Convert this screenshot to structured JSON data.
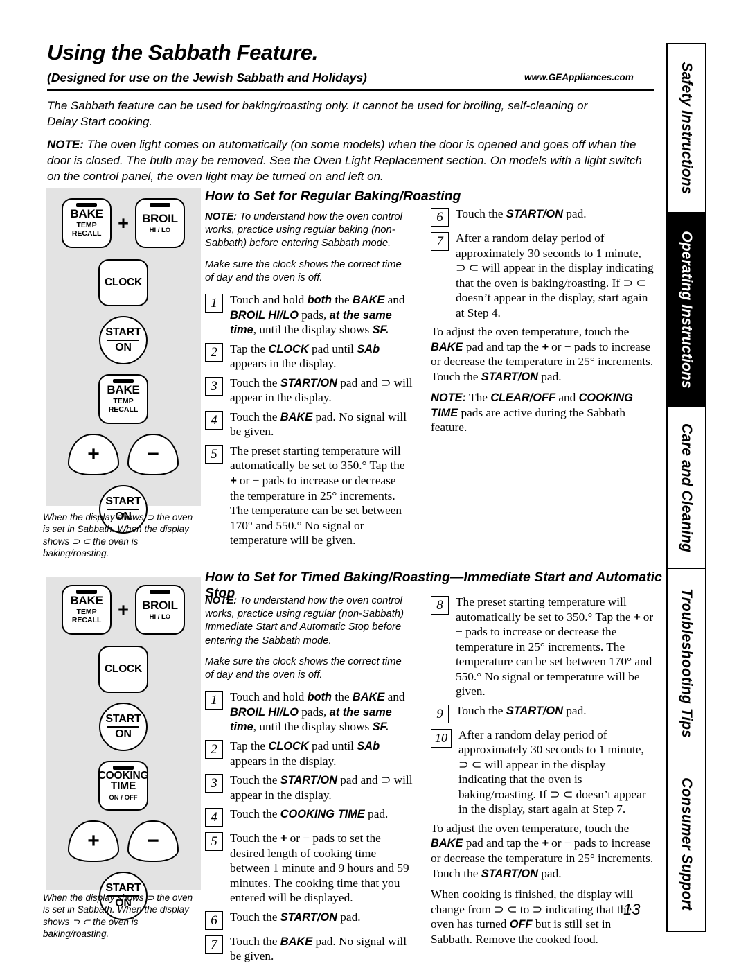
{
  "header": {
    "title": "Using the Sabbath Feature.",
    "subtitle": "(Designed for use on the Jewish Sabbath and Holidays)",
    "url": "www.GEAppliances.com"
  },
  "intro": {
    "paragraph": "The Sabbath feature can be used for baking/roasting only. It cannot be used for broiling, self-cleaning or Delay Start cooking.",
    "note_label": "NOTE:",
    "note_text": "The oven light comes on automatically (on some models) when the door is opened and goes off when the door is closed. The bulb may be removed. See the Oven Light Replacement section. On models with a light switch on the control panel, the oven light may be turned on and left on."
  },
  "sidebar": {
    "tabs": [
      {
        "label": "Safety Instructions",
        "active": false
      },
      {
        "label": "Operating Instructions",
        "active": true
      },
      {
        "label": "Care and Cleaning",
        "active": false
      },
      {
        "label": "Troubleshooting Tips",
        "active": false
      },
      {
        "label": "Consumer Support",
        "active": false
      }
    ]
  },
  "panel1": {
    "keys": {
      "bake": {
        "main": "BAKE",
        "sub": "TEMP\nRECALL"
      },
      "plus_sign": "+",
      "broil": {
        "main": "BROIL",
        "sub": "HI / LO"
      },
      "clock": "CLOCK",
      "start": {
        "line1": "START",
        "line2": "ON"
      },
      "bake2": {
        "main": "BAKE",
        "sub": "TEMP\nRECALL"
      },
      "plus_pad": "+",
      "minus_pad": "−",
      "start2": {
        "line1": "START",
        "line2": "ON"
      }
    },
    "caption": "When the display shows ⊃ the oven is set in Sabbath. When the display shows ⊃ ⊂ the oven is baking/roasting."
  },
  "panel2": {
    "keys": {
      "bake": {
        "main": "BAKE",
        "sub": "TEMP\nRECALL"
      },
      "plus_sign": "+",
      "broil": {
        "main": "BROIL",
        "sub": "HI / LO"
      },
      "clock": "CLOCK",
      "start": {
        "line1": "START",
        "line2": "ON"
      },
      "cooking_time": {
        "line1": "COOKING",
        "line2": "TIME",
        "sub": "ON / OFF"
      },
      "plus_pad": "+",
      "minus_pad": "−",
      "start2": {
        "line1": "START",
        "line2": "ON"
      }
    },
    "caption": "When the display shows ⊃ the oven is set in Sabbath. When the display shows ⊃ ⊂ the oven is baking/roasting."
  },
  "section1": {
    "heading": "How to Set for Regular Baking/Roasting",
    "note_label": "NOTE:",
    "note_text": "To understand how the oven control works, practice using regular baking (non-Sabbath) before entering Sabbath mode.",
    "note2": "Make sure the clock shows the correct time of day and the oven is off.",
    "steps": [
      {
        "num": "1",
        "text": "Touch and hold <b>both</b> the <b>BAKE</b> and <b>BROIL HI/LO</b> pads, <b>at the same time</b>, until the display shows <b>SF.</b>"
      },
      {
        "num": "2",
        "text": "Tap the <b>CLOCK</b> pad until <b>SAb</b> appears in the display."
      },
      {
        "num": "3",
        "text": "Touch the <b>START/ON</b> pad and ⊃ will appear in the display."
      },
      {
        "num": "4",
        "text": "Touch the <b>BAKE</b> pad. No signal will be given."
      },
      {
        "num": "5",
        "text": "The preset starting temperature will automatically be set to 350.° Tap the <b>+</b> or − pads to increase or decrease the temperature in 25° increments. The temperature can be set between 170° and 550.° No signal or temperature will be given."
      },
      {
        "num": "6",
        "text": "Touch the <b>START/ON</b> pad."
      },
      {
        "num": "7",
        "text": "After a random delay period of approximately 30 seconds to 1 minute, ⊃ ⊂ will appear in the display indicating that the oven is baking/roasting. If ⊃ ⊂ doesn’t appear in the display, start again at Step 4."
      }
    ],
    "closing1": "To adjust the oven temperature, touch the <b>BAKE</b> pad and tap the <b>+</b> or − pads to increase or decrease the temperature in 25° increments. Touch the <b>START/ON</b> pad.",
    "closing2_label": "NOTE:",
    "closing2": "The <b>CLEAR/OFF</b> and <b>COOKING TIME</b> pads are active during the Sabbath feature."
  },
  "section2": {
    "heading": "How to Set for Timed Baking/Roasting—Immediate Start and Automatic Stop",
    "note_label": "NOTE:",
    "note_text": "To understand how the oven control works, practice using regular (non-Sabbath) Immediate Start and Automatic Stop before entering the Sabbath mode.",
    "note2": "Make sure the clock shows the correct time of day and the oven is off.",
    "steps": [
      {
        "num": "1",
        "text": "Touch and hold <b>both</b> the <b>BAKE</b> and <b>BROIL HI/LO</b> pads, <b>at the same time</b>, until the display shows <b>SF.</b>"
      },
      {
        "num": "2",
        "text": "Tap the <b>CLOCK</b> pad until <b>SAb</b> appears in the display."
      },
      {
        "num": "3",
        "text": "Touch the <b>START/ON</b> pad and ⊃ will appear in the display."
      },
      {
        "num": "4",
        "text": "Touch the <b>COOKING TIME</b> pad."
      },
      {
        "num": "5",
        "text": "Touch the <b>+</b> or − pads to set the desired length of cooking time between 1 minute and 9 hours and 59 minutes. The cooking time that you entered will be displayed."
      },
      {
        "num": "6",
        "text": "Touch the <b>START/ON</b> pad."
      },
      {
        "num": "7",
        "text": "Touch the <b>BAKE</b> pad. No signal will be given."
      },
      {
        "num": "8",
        "text": "The preset starting temperature will automatically be set to 350.° Tap the <b>+</b> or − pads to increase or decrease the temperature in 25° increments. The temperature can be set between 170° and 550.° No signal or temperature will be given."
      },
      {
        "num": "9",
        "text": "Touch the <b>START/ON</b> pad."
      },
      {
        "num": "10",
        "text": "After a random delay period of approximately 30 seconds to 1 minute, ⊃ ⊂ will appear in the display indicating that the oven is baking/roasting. If ⊃ ⊂ doesn’t appear in the display, start again at Step 7."
      }
    ],
    "closing1": "To adjust the oven temperature, touch the <b>BAKE</b> pad and tap the <b>+</b> or − pads to increase or decrease the temperature in 25° increments. Touch the <b>START/ON</b> pad.",
    "closing2": "When cooking is finished, the display will change from ⊃ ⊂ to ⊃ indicating that the oven has turned <b>OFF</b> but is still set in Sabbath. Remove the cooked food."
  },
  "page_number": "13"
}
